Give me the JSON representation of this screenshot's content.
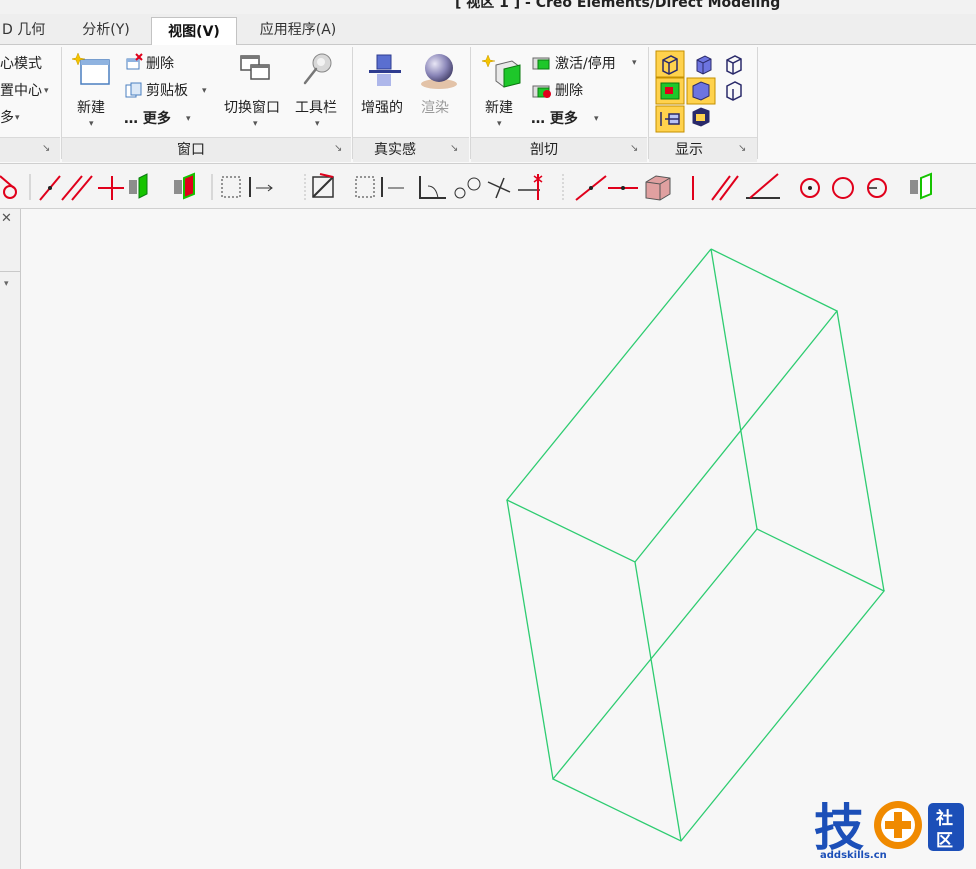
{
  "window": {
    "title": "[ 视区 1 ] - Creo Elements/Direct Modeling"
  },
  "tabs": [
    {
      "label": "D 几何"
    },
    {
      "label": "分析(Y)"
    },
    {
      "label": "视图(V)",
      "active": true
    },
    {
      "label": "应用程序(A)"
    }
  ],
  "ribbon": {
    "group0": {
      "items": [
        "心模式",
        "置中心",
        "多"
      ]
    },
    "window_group": {
      "label": "窗口",
      "new_label": "新建",
      "delete_label": "删除",
      "clipboard_label": "剪贴板",
      "more_label": "… 更多",
      "switch_window_label": "切换窗口",
      "toolbar_label": "工具栏"
    },
    "realism_group": {
      "label": "真实感",
      "enhanced_label": "增强的",
      "render_label": "渲染"
    },
    "section_group": {
      "label": "剖切",
      "new_label": "新建",
      "activate_label": "激活/停用",
      "delete_label": "删除",
      "more_label": "… 更多"
    },
    "display_group": {
      "label": "显示"
    }
  },
  "viewport": {
    "wireframe_color": "#2ecc71"
  },
  "watermark": {
    "brand_char": "技",
    "community_chars": [
      "社",
      "区"
    ],
    "url": "addskills.cn"
  },
  "colors": {
    "accent_red": "#e0001b",
    "accent_green": "#16c300",
    "display_highlight": "#ffd24d"
  }
}
